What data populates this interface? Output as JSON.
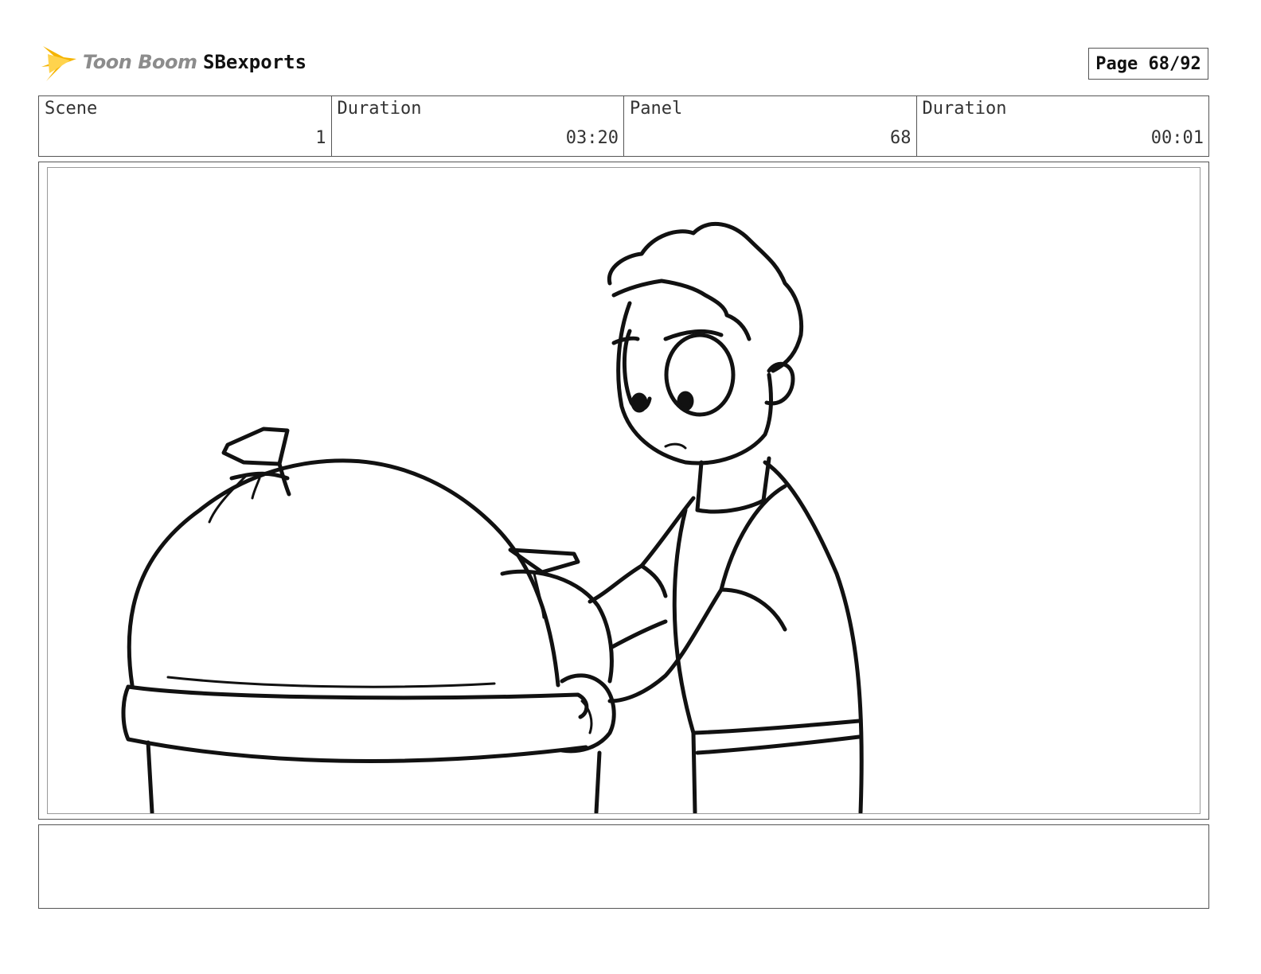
{
  "header": {
    "logo_text": "Toon Boom",
    "project_name": "SBexports",
    "page_label": "Page 68/92"
  },
  "info": {
    "scene_label": "Scene",
    "scene_value": "1",
    "scene_duration_label": "Duration",
    "scene_duration_value": "03:20",
    "panel_label": "Panel",
    "panel_value": "68",
    "panel_duration_label": "Duration",
    "panel_duration_value": "00:01"
  },
  "notes": {
    "text": ""
  },
  "colors": {
    "logo_star": "#f5b400",
    "logo_text": "#8c8c8c"
  }
}
